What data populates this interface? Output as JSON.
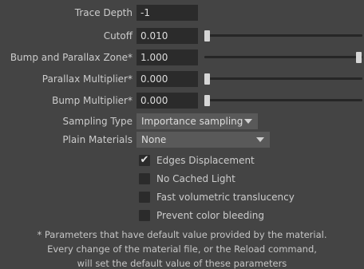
{
  "trace_depth": {
    "label": "Trace Depth",
    "value": "-1"
  },
  "cutoff": {
    "label": "Cutoff",
    "value": "0.010",
    "slider_fraction": 0.0
  },
  "bump_parallax_zone": {
    "label": "Bump and Parallax Zone*",
    "value": "1.000",
    "slider_fraction": 1.0
  },
  "parallax_multiplier": {
    "label": "Parallax Multiplier*",
    "value": "0.000",
    "slider_fraction": 0.0
  },
  "bump_multiplier": {
    "label": "Bump Multiplier*",
    "value": "0.000",
    "slider_fraction": 0.0
  },
  "sampling_type": {
    "label": "Sampling Type",
    "selected": "Importance sampling",
    "icon": "chevron-down-icon"
  },
  "plain_materials": {
    "label": "Plain Materials",
    "selected": "None",
    "icon": "chevron-down-icon"
  },
  "checkboxes": [
    {
      "label": "Edges Displacement",
      "checked": true,
      "check_glyph": "✔"
    },
    {
      "label": "No Cached Light",
      "checked": false,
      "check_glyph": ""
    },
    {
      "label": "Fast volumetric translucency",
      "checked": false,
      "check_glyph": ""
    },
    {
      "label": "Prevent color bleeding",
      "checked": false,
      "check_glyph": ""
    }
  ],
  "notes": [
    "* Parameters that have default value provided by the material.",
    "Every change of the material file, or the Reload command,",
    "will set the default value of these  parameters"
  ],
  "colors": {
    "background": "#444444",
    "field": "#2b2b2b",
    "dropdown": "#595959",
    "text": "#cccccc"
  }
}
